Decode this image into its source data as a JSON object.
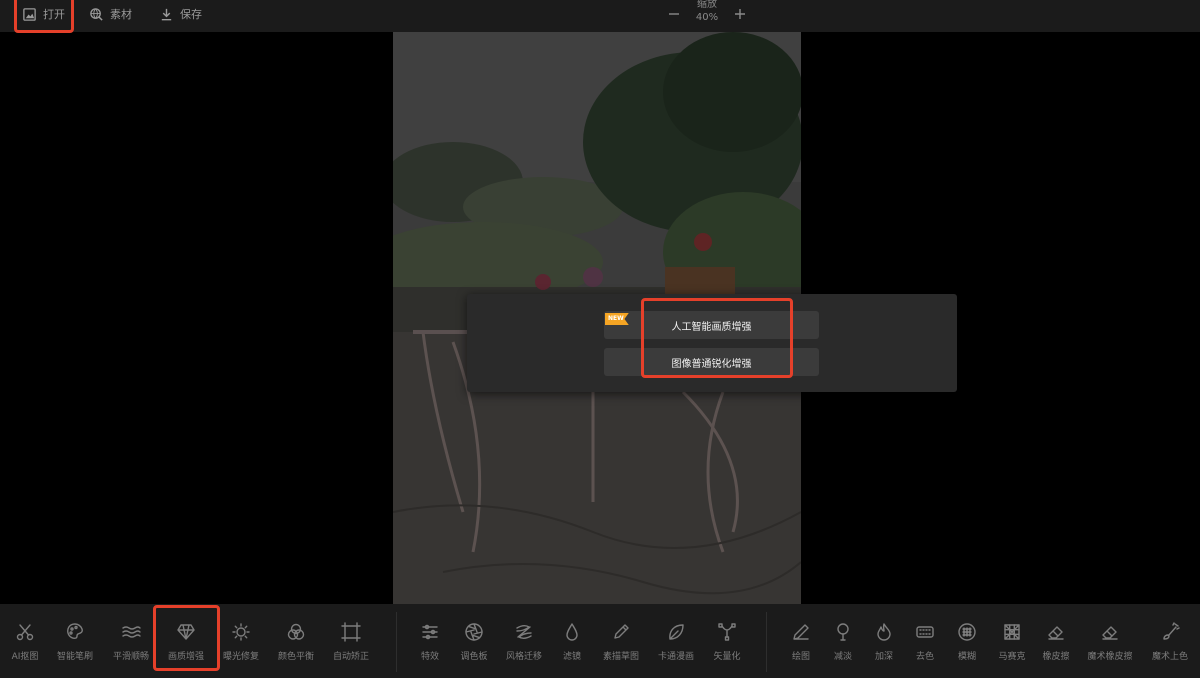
{
  "topbar": {
    "open_label": "打开",
    "material_label": "素材",
    "save_label": "保存",
    "zoom_label": "缩放",
    "zoom_value": "40%"
  },
  "popup": {
    "new_badge": "NEW",
    "ai_enhance_label": "人工智能画质增强",
    "sharpen_label": "图像普通锐化增强"
  },
  "toolbar": {
    "tools": [
      {
        "label": "AI抠图",
        "icon": "scissors-icon"
      },
      {
        "label": "智能笔刷",
        "icon": "palette-icon"
      },
      {
        "label": "平滑顺畅",
        "icon": "waves-icon"
      },
      {
        "label": "画质增强",
        "icon": "diamond-icon"
      },
      {
        "label": "曝光修复",
        "icon": "sun-icon"
      },
      {
        "label": "颜色平衡",
        "icon": "color-circles-icon"
      },
      {
        "label": "自动矫正",
        "icon": "crop-frame-icon"
      },
      {
        "label": "特效",
        "icon": "sliders-icon"
      },
      {
        "label": "调色板",
        "icon": "aperture-icon"
      },
      {
        "label": "风格迁移",
        "icon": "style-transfer-icon"
      },
      {
        "label": "滤镜",
        "icon": "droplet-icon"
      },
      {
        "label": "素描草图",
        "icon": "pencil-icon"
      },
      {
        "label": "卡通漫画",
        "icon": "leaf-icon"
      },
      {
        "label": "矢量化",
        "icon": "vector-nodes-icon"
      },
      {
        "label": "绘图",
        "icon": "pen-icon"
      },
      {
        "label": "减淡",
        "icon": "dodge-icon"
      },
      {
        "label": "加深",
        "icon": "flame-icon"
      },
      {
        "label": "去色",
        "icon": "desaturate-icon"
      },
      {
        "label": "模糊",
        "icon": "blur-icon"
      },
      {
        "label": "马赛克",
        "icon": "mosaic-icon"
      },
      {
        "label": "橡皮擦",
        "icon": "eraser-icon"
      },
      {
        "label": "魔术橡皮擦",
        "icon": "magic-eraser-icon"
      },
      {
        "label": "魔术上色",
        "icon": "magic-brush-icon"
      }
    ]
  },
  "colors": {
    "highlight": "#e5402a",
    "badge": "#f5a524",
    "panel": "#2a2a2a"
  }
}
